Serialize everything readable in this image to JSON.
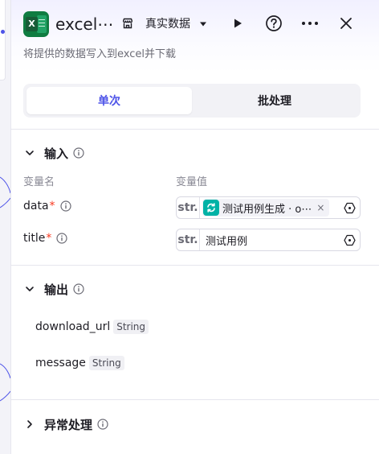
{
  "header": {
    "title": "excel⋯",
    "mode_label": "真实数据",
    "subtitle": "将提供的数据写入到excel并下载"
  },
  "tabs": [
    {
      "label": "单次",
      "active": true
    },
    {
      "label": "批处理",
      "active": false
    }
  ],
  "input_section": {
    "title": "输入",
    "col_name": "变量名",
    "col_value": "变量值",
    "rows": [
      {
        "name": "data",
        "required_mark": "*",
        "type": "str.",
        "ref_text": "测试用例生成 · o⋯",
        "ref_close": "×"
      },
      {
        "name": "title",
        "required_mark": "*",
        "type": "str.",
        "value": "测试用例"
      }
    ]
  },
  "output_section": {
    "title": "输出",
    "items": [
      {
        "name": "download_url",
        "type": "String"
      },
      {
        "name": "message",
        "type": "String"
      }
    ]
  },
  "exception_section": {
    "title": "异常处理"
  },
  "colors": {
    "accent": "#4d53e8",
    "excel_green": "#107c41",
    "ref_teal": "#00b2a6",
    "required": "#f93920"
  },
  "icons": [
    "excel-app-icon",
    "store-icon",
    "caret-down-icon",
    "play-icon",
    "help-icon",
    "more-icon",
    "close-icon",
    "chevron-down-icon",
    "chevron-right-icon",
    "info-icon",
    "loop-icon",
    "variable-picker-icon"
  ]
}
